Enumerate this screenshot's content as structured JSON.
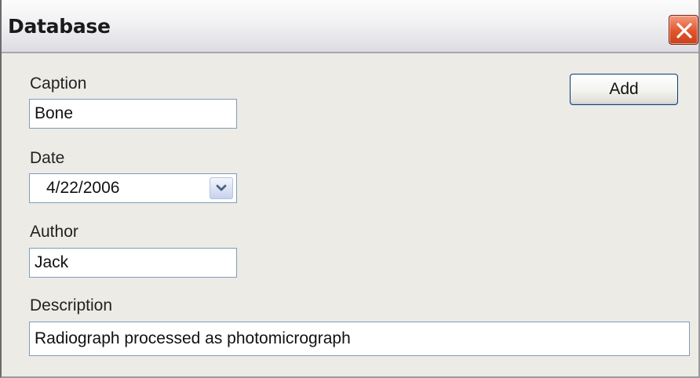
{
  "window": {
    "title": "Database"
  },
  "icons": {
    "close": "close-icon",
    "dropdown": "chevron-down-icon"
  },
  "form": {
    "caption": {
      "label": "Caption",
      "value": "Bone"
    },
    "date": {
      "label": "Date",
      "value": "4/22/2006"
    },
    "author": {
      "label": "Author",
      "value": "Jack"
    },
    "description": {
      "label": "Description",
      "value": "Radiograph processed as photomicrograph"
    }
  },
  "buttons": {
    "add_label": "Add"
  },
  "colors": {
    "window_bg": "#ecebe6",
    "field_border": "#7f9db9",
    "close_red": "#e2552d",
    "button_border": "#003c74"
  }
}
